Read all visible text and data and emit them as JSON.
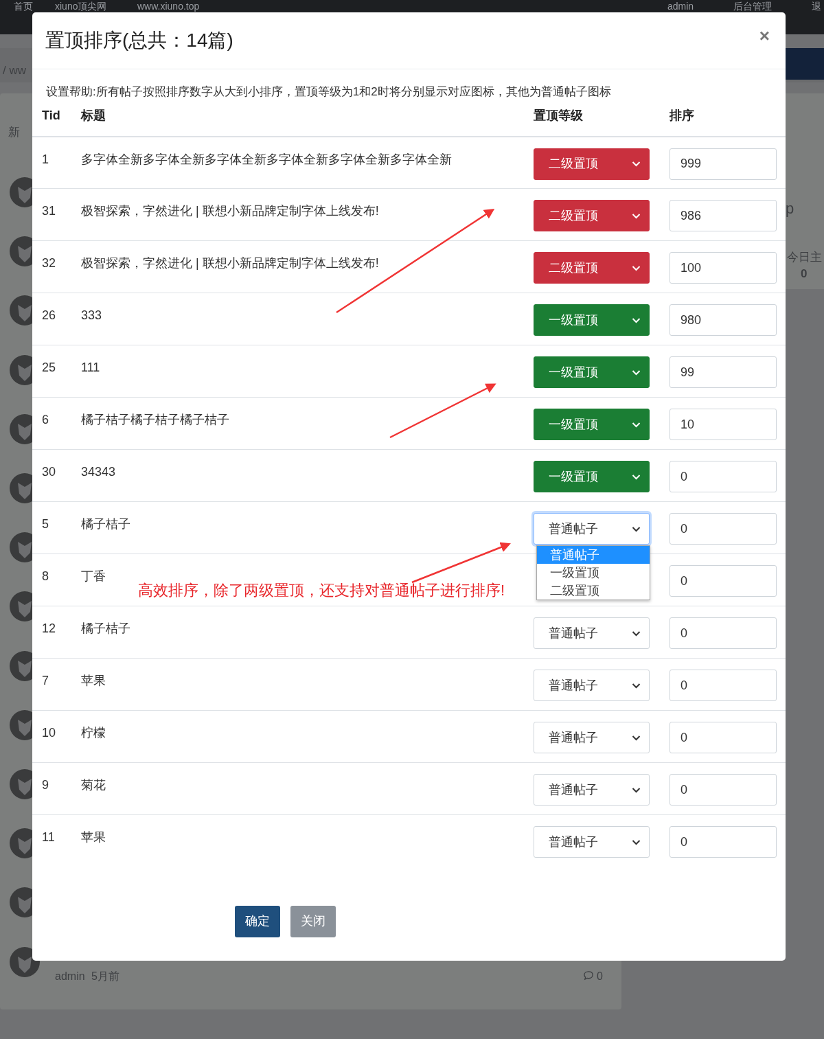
{
  "background": {
    "nav_links": [
      "首页",
      "xiuno顶尖网",
      "www.xiuno.top"
    ],
    "nav_user": "admin",
    "nav_admin": "后台管理",
    "nav_logout": "退",
    "breadcrumb": "/ ww",
    "tab": "新",
    "side_letter": "p",
    "stat_label": "今日主",
    "stat_value": "0",
    "post_author": "admin",
    "post_time": "5月前",
    "post_replies": "0"
  },
  "modal": {
    "title": "置顶排序(总共：14篇)",
    "close": "×",
    "help": "设置帮助:所有帖子按照排序数字从大到小排序，置顶等级为1和2时将分别显示对应图标，其他为普通帖子图标",
    "columns": [
      "Tid",
      "标题",
      "置顶等级",
      "排序"
    ],
    "rows": [
      {
        "tid": "1",
        "title": "多字体全新多字体全新多字体全新多字体全新多字体全新多字体全新",
        "kind": "second",
        "top_label": "二级置顶",
        "sort": "999",
        "focused": false
      },
      {
        "tid": "31",
        "title": "极智探索，字然进化 | 联想小新品牌定制字体上线发布!",
        "kind": "second",
        "top_label": "二级置顶",
        "sort": "986",
        "focused": false
      },
      {
        "tid": "32",
        "title": "极智探索，字然进化 | 联想小新品牌定制字体上线发布!",
        "kind": "second",
        "top_label": "二级置顶",
        "sort": "100",
        "focused": false
      },
      {
        "tid": "26",
        "title": "333",
        "kind": "first",
        "top_label": "一级置顶",
        "sort": "980",
        "focused": false
      },
      {
        "tid": "25",
        "title": "111",
        "kind": "first",
        "top_label": "一级置顶",
        "sort": "99",
        "focused": false
      },
      {
        "tid": "6",
        "title": "橘子桔子橘子桔子橘子桔子",
        "kind": "first",
        "top_label": "一级置顶",
        "sort": "10",
        "focused": false
      },
      {
        "tid": "30",
        "title": "34343",
        "kind": "first",
        "top_label": "一级置顶",
        "sort": "0",
        "focused": false
      },
      {
        "tid": "5",
        "title": "橘子桔子",
        "kind": "normal",
        "top_label": "普通帖子",
        "sort": "0",
        "focused": true,
        "options": [
          {
            "label": "普通帖子",
            "selected": true
          },
          {
            "label": "一级置顶",
            "selected": false
          },
          {
            "label": "二级置顶",
            "selected": false
          }
        ]
      },
      {
        "tid": "8",
        "title": "丁香",
        "sort": "0"
      },
      {
        "tid": "12",
        "title": "橘子桔子",
        "kind": "normal",
        "top_label": "普通帖子",
        "sort": "0",
        "focused": false
      },
      {
        "tid": "7",
        "title": "苹果",
        "kind": "normal",
        "top_label": "普通帖子",
        "sort": "0",
        "focused": false
      },
      {
        "tid": "10",
        "title": "柠檬",
        "kind": "normal",
        "top_label": "普通帖子",
        "sort": "0",
        "focused": false
      },
      {
        "tid": "9",
        "title": "菊花",
        "kind": "normal",
        "top_label": "普通帖子",
        "sort": "0",
        "focused": false
      },
      {
        "tid": "11",
        "title": "苹果",
        "kind": "normal",
        "top_label": "普通帖子",
        "sort": "0",
        "focused": false
      }
    ],
    "buttons": [
      {
        "label": "确定",
        "kind": "primary"
      },
      {
        "label": "关闭",
        "kind": "secondary"
      }
    ]
  },
  "annotation": {
    "text": "高效排序，除了两级置顶，还支持对普通帖子进行排序!"
  }
}
